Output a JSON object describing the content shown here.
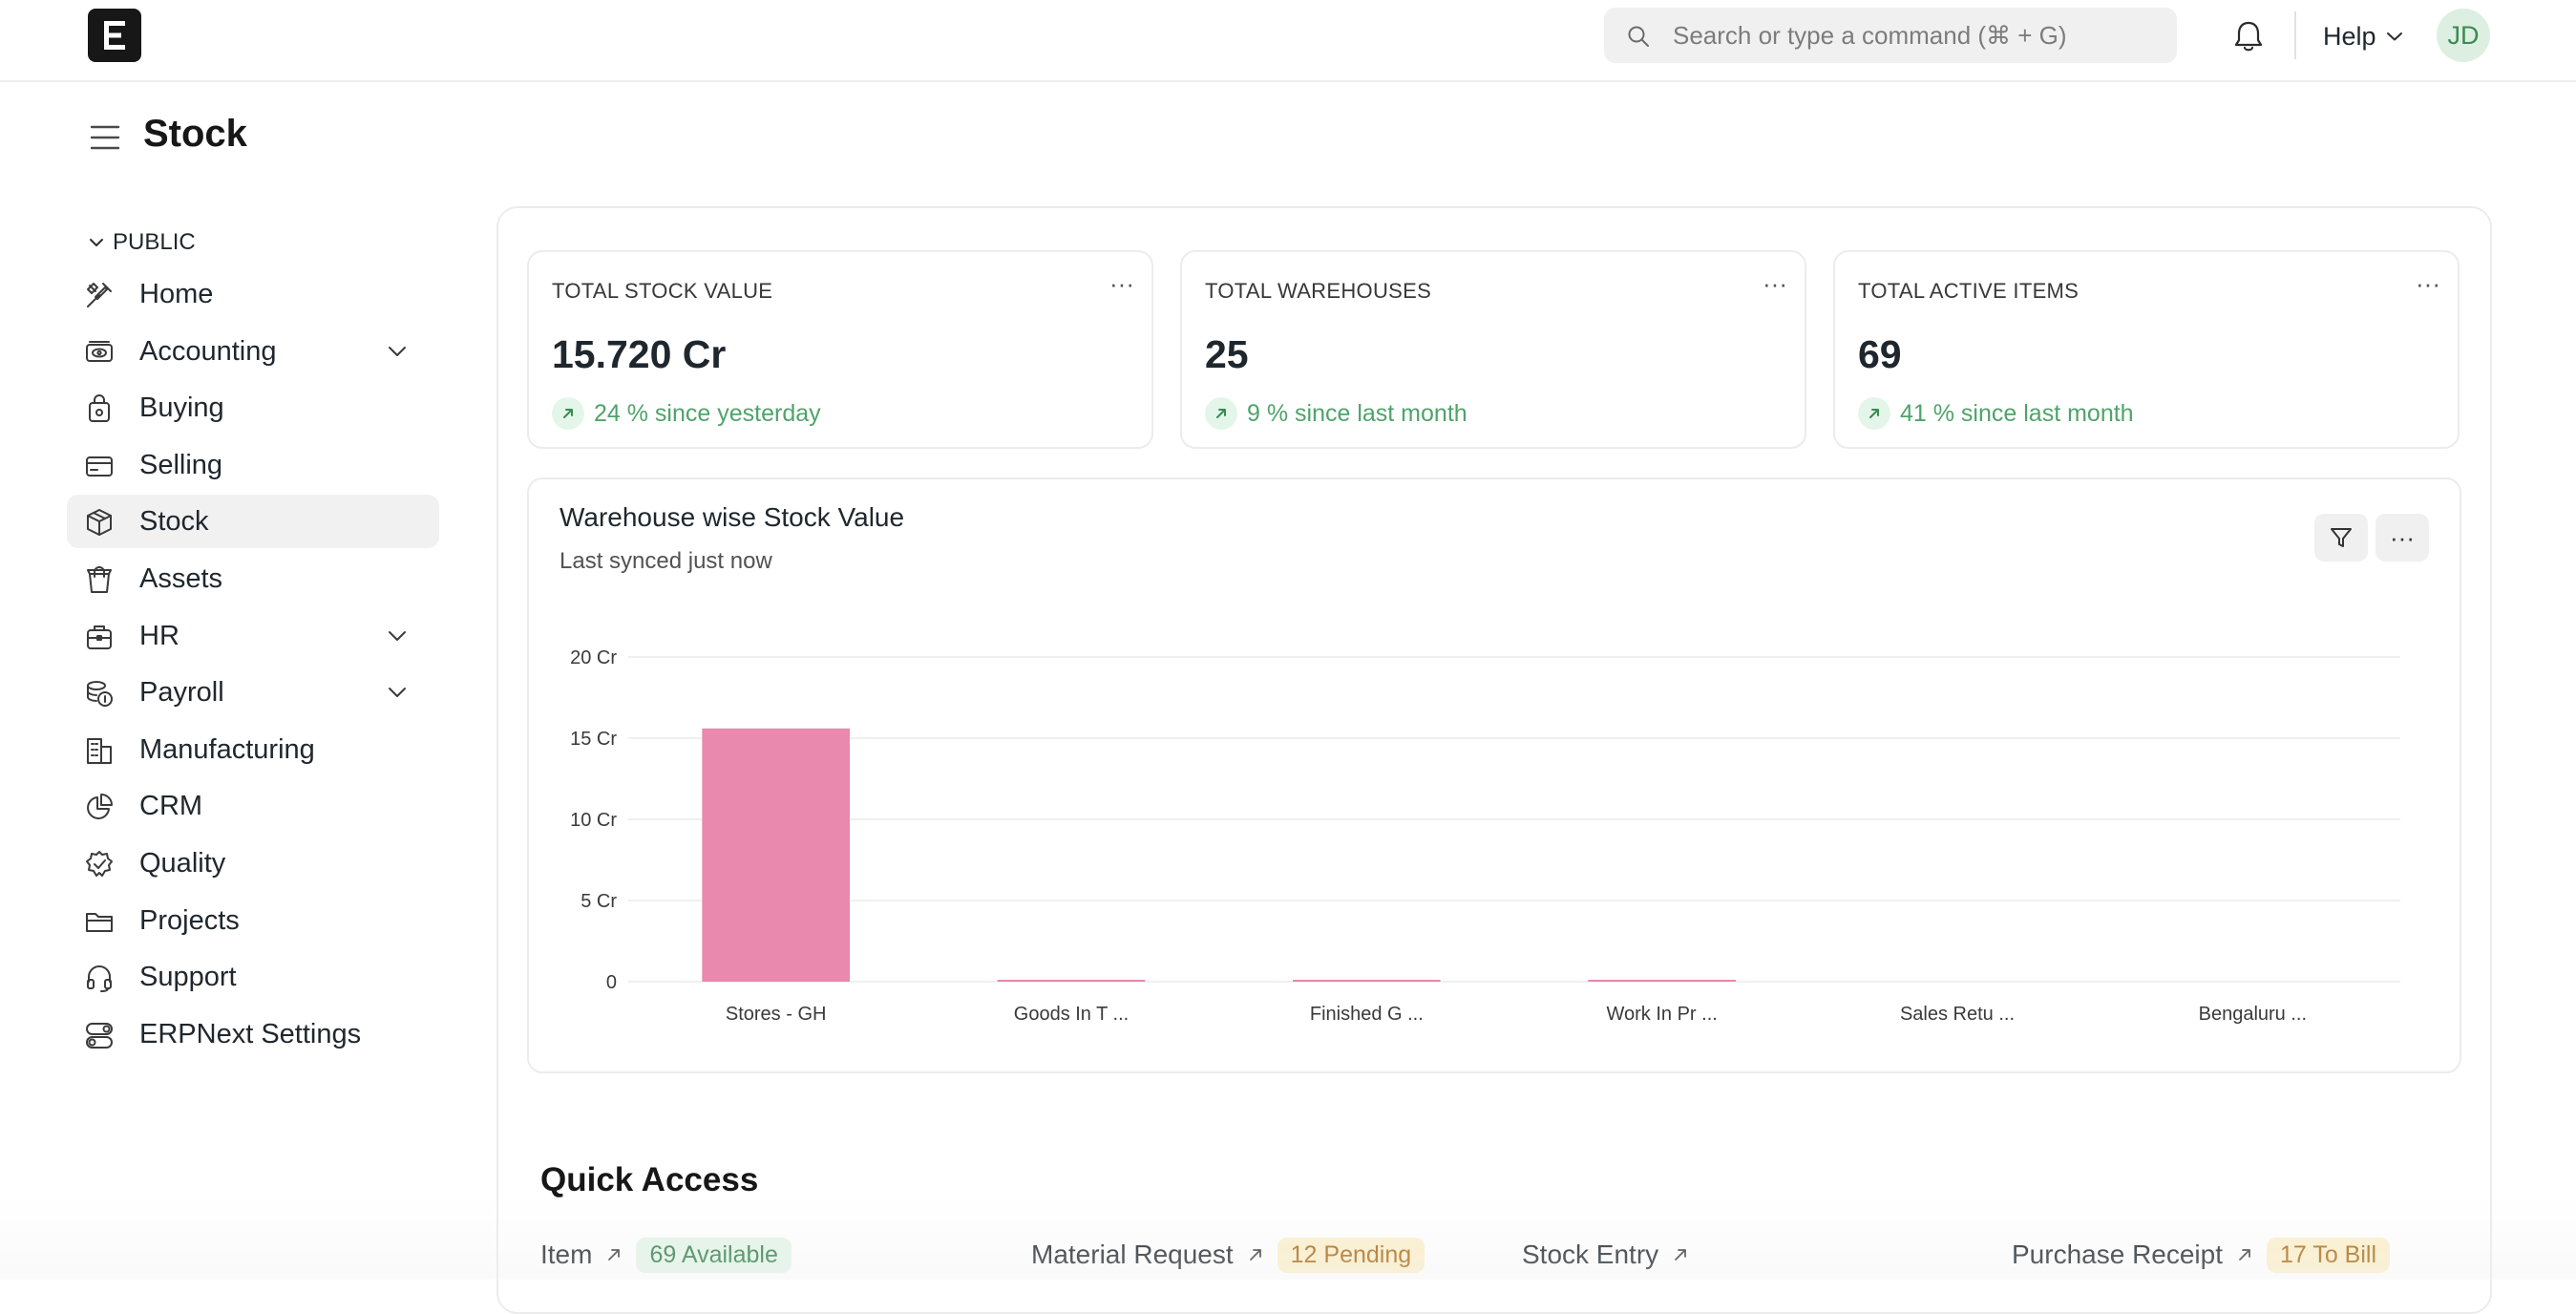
{
  "navbar": {
    "logo_letter": "E",
    "search_placeholder": "Search or type a command (⌘ + G)",
    "help_label": "Help",
    "avatar_initials": "JD"
  },
  "page": {
    "title": "Stock"
  },
  "sidebar": {
    "section_label": "PUBLIC",
    "items": [
      {
        "label": "Home",
        "icon": "tools-icon",
        "expandable": false,
        "active": false
      },
      {
        "label": "Accounting",
        "icon": "money-eye-icon",
        "expandable": true,
        "active": false
      },
      {
        "label": "Buying",
        "icon": "shopping-bag-icon",
        "expandable": false,
        "active": false
      },
      {
        "label": "Selling",
        "icon": "card-icon",
        "expandable": false,
        "active": false
      },
      {
        "label": "Stock",
        "icon": "box-icon",
        "expandable": false,
        "active": true
      },
      {
        "label": "Assets",
        "icon": "bag-icon",
        "expandable": false,
        "active": false
      },
      {
        "label": "HR",
        "icon": "briefcase-icon",
        "expandable": true,
        "active": false
      },
      {
        "label": "Payroll",
        "icon": "coins-icon",
        "expandable": true,
        "active": false
      },
      {
        "label": "Manufacturing",
        "icon": "building-icon",
        "expandable": false,
        "active": false
      },
      {
        "label": "CRM",
        "icon": "pie-chart-icon",
        "expandable": false,
        "active": false
      },
      {
        "label": "Quality",
        "icon": "badge-check-icon",
        "expandable": false,
        "active": false
      },
      {
        "label": "Projects",
        "icon": "folder-icon",
        "expandable": false,
        "active": false
      },
      {
        "label": "Support",
        "icon": "headset-icon",
        "expandable": false,
        "active": false
      },
      {
        "label": "ERPNext Settings",
        "icon": "toggles-icon",
        "expandable": false,
        "active": false
      }
    ]
  },
  "number_cards": [
    {
      "title": "TOTAL STOCK VALUE",
      "value": "15.720 Cr",
      "trend": "24 % since yesterday",
      "menu": "···"
    },
    {
      "title": "TOTAL WAREHOUSES",
      "value": "25",
      "trend": "9 % since last month",
      "menu": "···"
    },
    {
      "title": "TOTAL ACTIVE ITEMS",
      "value": "69",
      "trend": "41 % since last month",
      "menu": "···"
    }
  ],
  "chart": {
    "title": "Warehouse wise Stock Value",
    "subtitle": "Last synced just now",
    "filter_icon": "filter-icon",
    "menu_label": "···"
  },
  "chart_data": {
    "type": "bar",
    "title": "Warehouse wise Stock Value",
    "xlabel": "",
    "ylabel": "",
    "categories": [
      "Stores - GH",
      "Goods In T ...",
      "Finished G ...",
      "Work In Pr ...",
      "Sales Retu ...",
      "Bengaluru ..."
    ],
    "values": [
      15.6,
      0.05,
      0.05,
      0.03,
      0,
      0
    ],
    "yticks": [
      "0",
      "5 Cr",
      "10 Cr",
      "15 Cr",
      "20 Cr"
    ],
    "ytick_values": [
      0,
      5,
      10,
      15,
      20
    ],
    "ylim": [
      0,
      20
    ],
    "unit": "Cr",
    "grid": true,
    "bar_color": "#e889ad"
  },
  "quick_access": {
    "title": "Quick Access",
    "items": [
      {
        "label": "Item",
        "badge": "69 Available",
        "badge_color": "green"
      },
      {
        "label": "Material Request",
        "badge": "12 Pending",
        "badge_color": "yellow"
      },
      {
        "label": "Stock Entry",
        "badge": "",
        "badge_color": ""
      },
      {
        "label": "Purchase Receipt",
        "badge": "17 To Bill",
        "badge_color": "yellow"
      }
    ]
  },
  "colors": {
    "accent_green": "#4fa36a",
    "bar_pink": "#e889ad",
    "badge_green_bg": "#e4f5e9",
    "badge_yellow_bg": "#fcf0cc"
  }
}
